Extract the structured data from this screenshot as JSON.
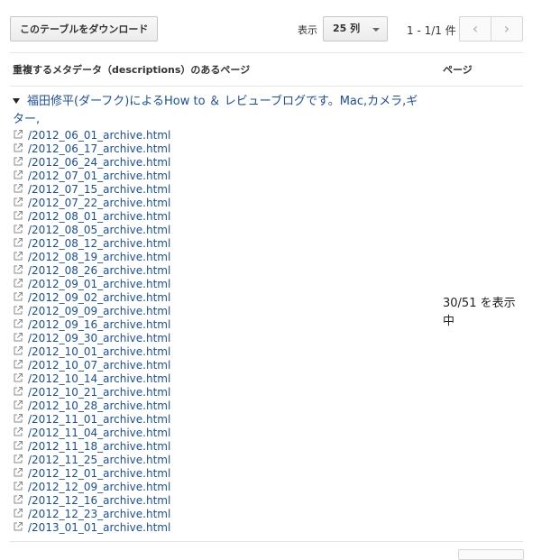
{
  "toolbar": {
    "download_label": "このテーブルをダウンロード",
    "show_label": "表示",
    "rows_value": "25 列",
    "page_range": "1 - 1/1 件",
    "prev_glyph": "‹",
    "next_glyph": "›"
  },
  "table": {
    "headers": {
      "pages": "重複するメタデータ（descriptions）のあるページ",
      "page_count": "ページ"
    },
    "group": {
      "title": "福田修平(ダーフク)によるHow to ＆ レビューブログです。Mac,カメラ,ギター,",
      "count_text": "30/51 を表示中",
      "links": [
        "/2012_06_01_archive.html",
        "/2012_06_17_archive.html",
        "/2012_06_24_archive.html",
        "/2012_07_01_archive.html",
        "/2012_07_15_archive.html",
        "/2012_07_22_archive.html",
        "/2012_08_01_archive.html",
        "/2012_08_05_archive.html",
        "/2012_08_12_archive.html",
        "/2012_08_19_archive.html",
        "/2012_08_26_archive.html",
        "/2012_09_01_archive.html",
        "/2012_09_02_archive.html",
        "/2012_09_09_archive.html",
        "/2012_09_16_archive.html",
        "/2012_09_30_archive.html",
        "/2012_10_01_archive.html",
        "/2012_10_07_archive.html",
        "/2012_10_14_archive.html",
        "/2012_10_21_archive.html",
        "/2012_10_28_archive.html",
        "/2012_11_01_archive.html",
        "/2012_11_04_archive.html",
        "/2012_11_18_archive.html",
        "/2012_11_25_archive.html",
        "/2012_12_01_archive.html",
        "/2012_12_09_archive.html",
        "/2012_12_16_archive.html",
        "/2012_12_23_archive.html",
        "/2013_01_01_archive.html"
      ]
    }
  },
  "icons": {
    "group_toggle": "triangle-down-icon",
    "link": "external-link-icon"
  },
  "colors": {
    "link": "#1a4fa0",
    "divider": "#e5e5e5"
  }
}
